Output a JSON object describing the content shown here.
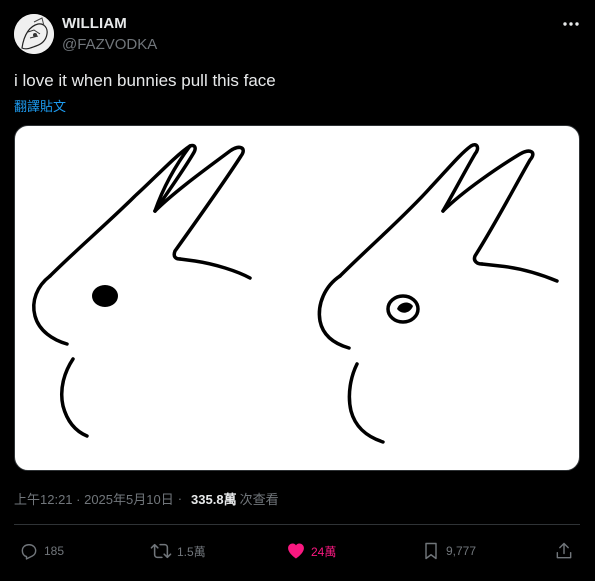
{
  "author": {
    "display_name": "WILLIAM",
    "handle": "@FAZVODKA",
    "avatar_icon": "avatar-sketch-icon"
  },
  "tweet": {
    "text": "i love it when bunnies pull this face",
    "translate_label": "翻譯貼文",
    "media_description_icon": "bunny-drawings-image"
  },
  "meta": {
    "timestamp": "上午12:21 · 2025年5月10日",
    "separator": "·",
    "views_count": "335.8萬",
    "views_label": "次查看"
  },
  "actions": {
    "reply": {
      "count": "185",
      "icon": "reply-icon"
    },
    "retweet": {
      "count": "1.5萬",
      "icon": "retweet-icon"
    },
    "like": {
      "count": "24萬",
      "icon": "heart-filled-icon",
      "liked": true
    },
    "bookmark": {
      "count": "9,777",
      "icon": "bookmark-icon"
    },
    "share": {
      "icon": "share-icon"
    }
  },
  "colors": {
    "background": "#000000",
    "text_primary": "#e7e9ea",
    "text_secondary": "#71767b",
    "link": "#1d9bf0",
    "like_active": "#f91880",
    "divider": "#2f3336"
  }
}
